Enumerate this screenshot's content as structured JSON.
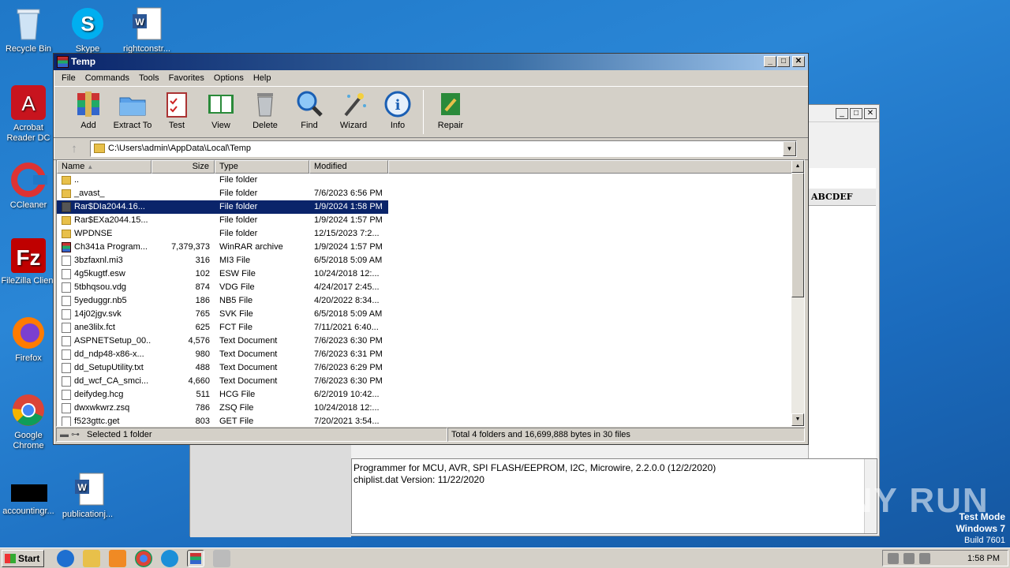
{
  "desktop": {
    "icons": [
      {
        "label": "Recycle Bin",
        "icon": "recycle-bin-icon"
      },
      {
        "label": "Skype",
        "icon": "skype-icon"
      },
      {
        "label": "rightconstr...",
        "icon": "word-doc-icon"
      },
      {
        "label": "Acrobat Reader DC",
        "icon": "acrobat-icon"
      },
      {
        "label": "CCleaner",
        "icon": "ccleaner-icon"
      },
      {
        "label": "FileZilla Client",
        "icon": "filezilla-icon"
      },
      {
        "label": "Firefox",
        "icon": "firefox-icon"
      },
      {
        "label": "Google Chrome",
        "icon": "chrome-icon"
      },
      {
        "label": "accountingr...",
        "icon": "black-file-icon"
      },
      {
        "label": "publicationj...",
        "icon": "word-doc-icon"
      }
    ]
  },
  "bg_window": {
    "header_text": "ABCDEF",
    "log_lines": [
      "Programmer for MCU, AVR, SPI FLASH/EEPROM, I2C, Microwire, 2.2.0.0 (12/2/2020)",
      "chiplist.dat Version: 11/22/2020"
    ]
  },
  "window": {
    "title": "Temp",
    "menu": [
      "File",
      "Commands",
      "Tools",
      "Favorites",
      "Options",
      "Help"
    ],
    "toolbar": [
      {
        "label": "Add",
        "icon": "add-archive-icon"
      },
      {
        "label": "Extract To",
        "icon": "extract-folder-icon"
      },
      {
        "label": "Test",
        "icon": "test-clipboard-icon"
      },
      {
        "label": "View",
        "icon": "view-book-icon"
      },
      {
        "label": "Delete",
        "icon": "trash-icon"
      },
      {
        "label": "Find",
        "icon": "magnifier-icon"
      },
      {
        "label": "Wizard",
        "icon": "wand-icon"
      },
      {
        "label": "Info",
        "icon": "info-icon"
      },
      {
        "label": "Repair",
        "icon": "repair-icon"
      }
    ],
    "path": "C:\\Users\\admin\\AppData\\Local\\Temp",
    "columns": {
      "name": "Name",
      "size": "Size",
      "type": "Type",
      "modified": "Modified"
    },
    "files": [
      {
        "name": "..",
        "size": "",
        "type": "File folder",
        "modified": "",
        "icon": "folder"
      },
      {
        "name": "_avast_",
        "size": "",
        "type": "File folder",
        "modified": "7/6/2023 6:56 PM",
        "icon": "folder"
      },
      {
        "name": "Rar$DIa2044.16...",
        "size": "",
        "type": "File folder",
        "modified": "1/9/2024 1:58 PM",
        "icon": "selfold",
        "selected": true
      },
      {
        "name": "Rar$EXa2044.15...",
        "size": "",
        "type": "File folder",
        "modified": "1/9/2024 1:57 PM",
        "icon": "folder"
      },
      {
        "name": "WPDNSE",
        "size": "",
        "type": "File folder",
        "modified": "12/15/2023 7:2...",
        "icon": "folder"
      },
      {
        "name": "Ch341a Program...",
        "size": "7,379,373",
        "type": "WinRAR archive",
        "modified": "1/9/2024 1:57 PM",
        "icon": "rar"
      },
      {
        "name": "3bzfaxnl.mi3",
        "size": "316",
        "type": "MI3 File",
        "modified": "6/5/2018 5:09 AM",
        "icon": "doc"
      },
      {
        "name": "4g5kugtf.esw",
        "size": "102",
        "type": "ESW File",
        "modified": "10/24/2018 12:...",
        "icon": "doc"
      },
      {
        "name": "5tbhqsou.vdg",
        "size": "874",
        "type": "VDG File",
        "modified": "4/24/2017 2:45...",
        "icon": "doc"
      },
      {
        "name": "5yeduggr.nb5",
        "size": "186",
        "type": "NB5 File",
        "modified": "4/20/2022 8:34...",
        "icon": "doc"
      },
      {
        "name": "14j02jgv.svk",
        "size": "765",
        "type": "SVK File",
        "modified": "6/5/2018 5:09 AM",
        "icon": "doc"
      },
      {
        "name": "ane3lilx.fct",
        "size": "625",
        "type": "FCT File",
        "modified": "7/11/2021 6:40...",
        "icon": "doc"
      },
      {
        "name": "ASPNETSetup_00...",
        "size": "4,576",
        "type": "Text Document",
        "modified": "7/6/2023 6:30 PM",
        "icon": "doc"
      },
      {
        "name": "dd_ndp48-x86-x...",
        "size": "980",
        "type": "Text Document",
        "modified": "7/6/2023 6:31 PM",
        "icon": "doc"
      },
      {
        "name": "dd_SetupUtility.txt",
        "size": "488",
        "type": "Text Document",
        "modified": "7/6/2023 6:29 PM",
        "icon": "doc"
      },
      {
        "name": "dd_wcf_CA_smci...",
        "size": "4,660",
        "type": "Text Document",
        "modified": "7/6/2023 6:30 PM",
        "icon": "doc"
      },
      {
        "name": "deifydeg.hcg",
        "size": "511",
        "type": "HCG File",
        "modified": "6/2/2019 10:42...",
        "icon": "doc"
      },
      {
        "name": "dwxwkwrz.zsq",
        "size": "786",
        "type": "ZSQ File",
        "modified": "10/24/2018 12:...",
        "icon": "doc"
      },
      {
        "name": "f523gttc.get",
        "size": "803",
        "type": "GET File",
        "modified": "7/20/2021 3:54...",
        "icon": "doc"
      }
    ],
    "status_left": "Selected 1 folder",
    "status_right": "Total 4 folders and 16,699,888 bytes in 30 files"
  },
  "taskbar": {
    "start": "Start",
    "clock": "1:58 PM"
  },
  "watermark": {
    "line1": "Test Mode",
    "line2": "Windows 7",
    "line3": "Build 7601"
  },
  "brand": "ANY RUN"
}
